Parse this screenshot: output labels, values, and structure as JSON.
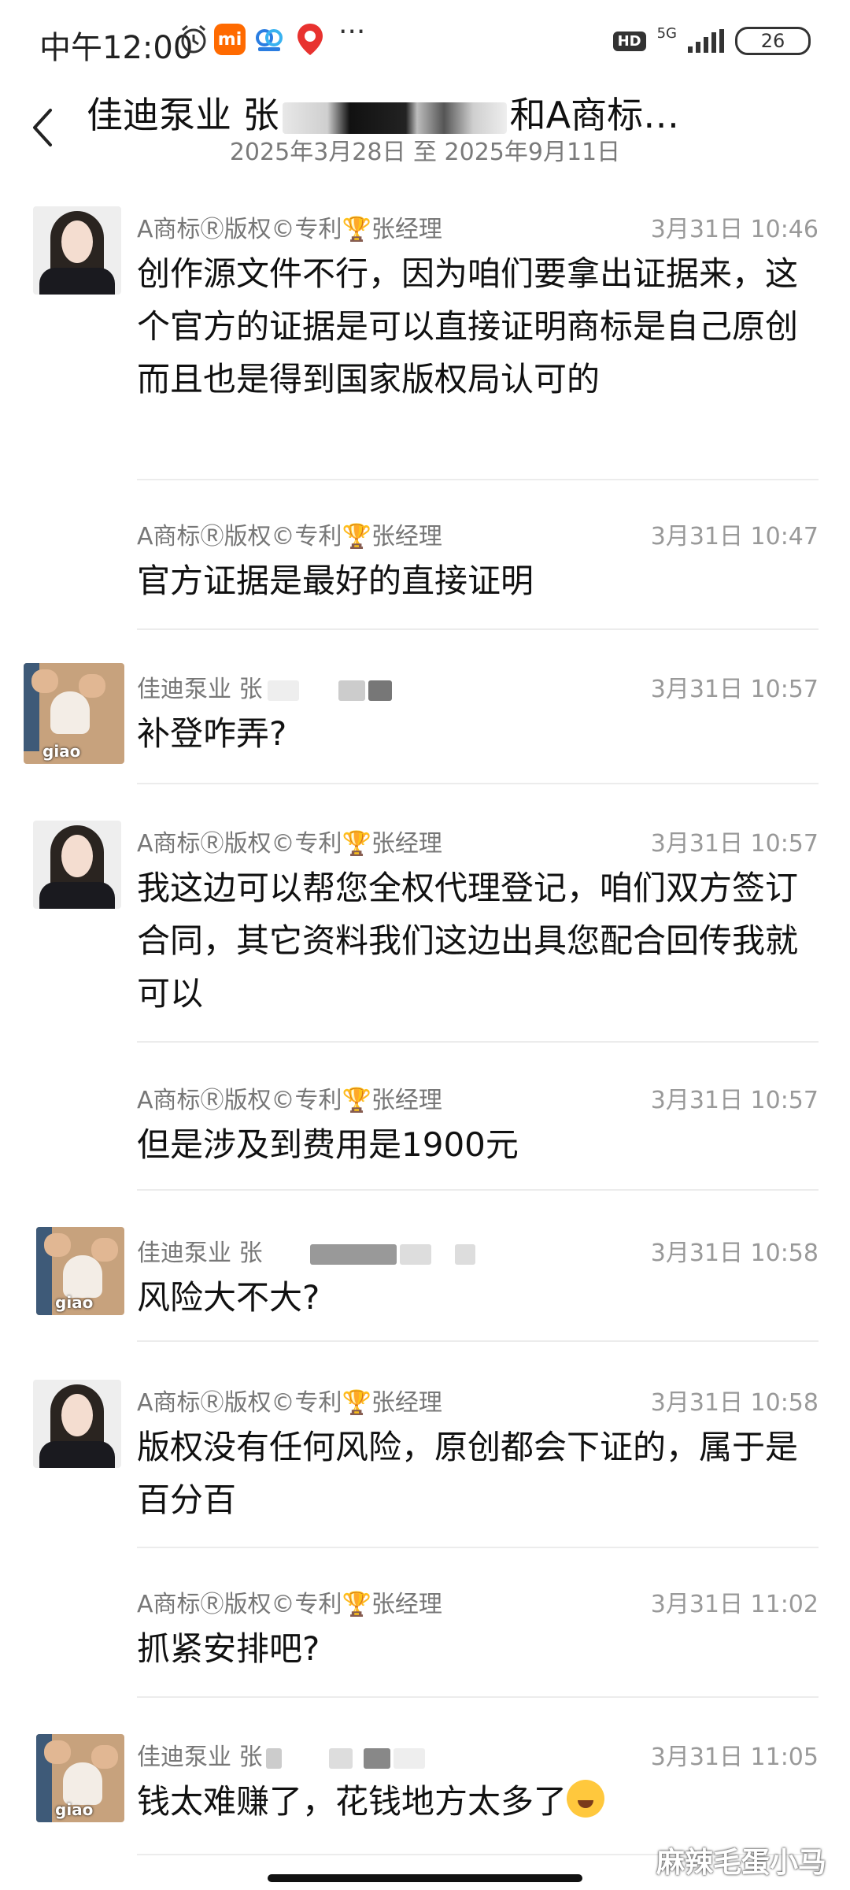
{
  "status_bar": {
    "time": "中午12:00",
    "hd": "HD",
    "network": "5G",
    "battery": "26"
  },
  "header": {
    "title_prefix": "佳迪泵业 张",
    "title_suffix": "和A商标…",
    "date_range": "2025年3月28日 至 2025年9月11日"
  },
  "messages": [
    {
      "sender": "A商标Ⓡ版权©专利🏆张经理",
      "time": "3月31日 10:46",
      "text": "创作源文件不行，因为咱们要拿出证据来，这个官方的证据是可以直接证明商标是自己原创而且也是得到国家版权局认可的"
    },
    {
      "sender": "A商标Ⓡ版权©专利🏆张经理",
      "time": "3月31日 10:47",
      "text": "官方证据是最好的直接证明"
    },
    {
      "sender": "佳迪泵业 张",
      "time": "3月31日 10:57",
      "text": "补登咋弄?"
    },
    {
      "sender": "A商标Ⓡ版权©专利🏆张经理",
      "time": "3月31日 10:57",
      "text": "我这边可以帮您全权代理登记，咱们双方签订合同，其它资料我们这边出具您配合回传我就可以"
    },
    {
      "sender": "A商标Ⓡ版权©专利🏆张经理",
      "time": "3月31日 10:57",
      "text": "但是涉及到费用是1900元"
    },
    {
      "sender": "佳迪泵业 张",
      "time": "3月31日 10:58",
      "text": "风险大不大?"
    },
    {
      "sender": "A商标Ⓡ版权©专利🏆张经理",
      "time": "3月31日 10:58",
      "text": "版权没有任何风险，原创都会下证的，属于是百分百"
    },
    {
      "sender": "A商标Ⓡ版权©专利🏆张经理",
      "time": "3月31日 11:02",
      "text": "抓紧安排吧?"
    },
    {
      "sender": "佳迪泵业 张",
      "time": "3月31日 11:05",
      "text": "钱太难赚了，花钱地方太多了"
    }
  ],
  "avatars": {
    "user_label": "giao"
  },
  "watermark": "麻辣毛蛋小马",
  "icons": [
    "alarm-icon",
    "mi-app-icon",
    "baidu-netdisk-icon",
    "du-map-icon",
    "more-icon",
    "hd-icon",
    "signal-icon",
    "battery-icon",
    "back-icon",
    "crying-laughing-emoji"
  ]
}
